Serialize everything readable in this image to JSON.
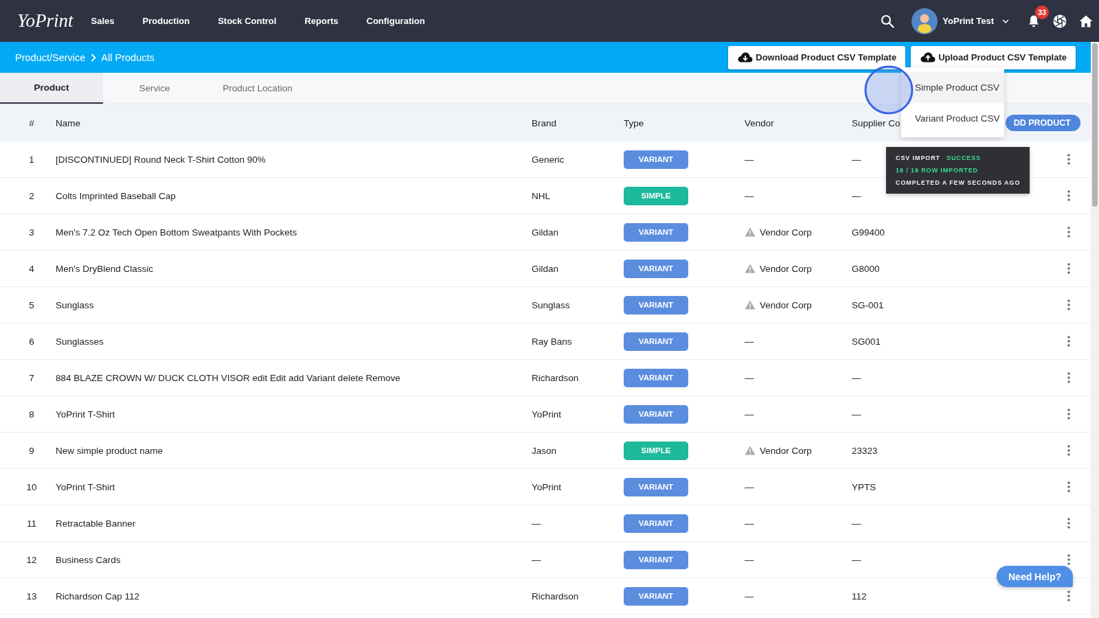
{
  "nav": {
    "logo": "YoPrint",
    "menu": [
      "Sales",
      "Production",
      "Stock Control",
      "Reports",
      "Configuration"
    ],
    "user": "YoPrint Test",
    "notification_count": "33"
  },
  "header_bar": {
    "breadcrumb": [
      "Product/Service",
      "All Products"
    ],
    "buttons": [
      {
        "label": "Download Product CSV Template",
        "kind": "download"
      },
      {
        "label": "Upload Product CSV Template",
        "kind": "upload"
      }
    ]
  },
  "upload_menu": {
    "items": [
      {
        "label": "Simple Product CSV",
        "highlighted": true
      },
      {
        "label": "Variant Product CSV",
        "highlighted": false
      }
    ]
  },
  "tabs": [
    {
      "label": "Product",
      "selected": true
    },
    {
      "label": "Service",
      "selected": false
    },
    {
      "label": "Product Location",
      "selected": false
    }
  ],
  "table": {
    "columns": [
      "#",
      "Name",
      "Brand",
      "Type",
      "Vendor",
      "Supplier Co"
    ],
    "add_button": "DD PRODUCT",
    "rows": [
      {
        "no": "1",
        "name": "[DISCONTINUED] Round Neck T-Shirt Cotton 90%",
        "brand": "Generic",
        "type": {
          "label": "VARIANT",
          "color": "#5b8ddf"
        },
        "vendor": "—",
        "vendor_warning": false,
        "supplier_code": "—"
      },
      {
        "no": "2",
        "name": "Colts Imprinted Baseball Cap",
        "brand": "NHL",
        "type": {
          "label": "SIMPLE",
          "color": "#1cb99b"
        },
        "vendor": "—",
        "vendor_warning": false,
        "supplier_code": "—"
      },
      {
        "no": "3",
        "name": "Men's 7.2 Oz Tech Open Bottom Sweatpants With Pockets",
        "brand": "Gildan",
        "type": {
          "label": "VARIANT",
          "color": "#5b8ddf"
        },
        "vendor": "Vendor Corp",
        "vendor_warning": true,
        "supplier_code": "G99400"
      },
      {
        "no": "4",
        "name": "Men's DryBlend Classic",
        "brand": "Gildan",
        "type": {
          "label": "VARIANT",
          "color": "#5b8ddf"
        },
        "vendor": "Vendor Corp",
        "vendor_warning": true,
        "supplier_code": "G8000"
      },
      {
        "no": "5",
        "name": "Sunglass",
        "brand": "Sunglass",
        "type": {
          "label": "VARIANT",
          "color": "#5b8ddf"
        },
        "vendor": "Vendor Corp",
        "vendor_warning": true,
        "supplier_code": "SG-001"
      },
      {
        "no": "6",
        "name": "Sunglasses",
        "brand": "Ray Bans",
        "type": {
          "label": "VARIANT",
          "color": "#5b8ddf"
        },
        "vendor": "—",
        "vendor_warning": false,
        "supplier_code": "SG001"
      },
      {
        "no": "7",
        "name": "884 BLAZE CROWN W/ DUCK CLOTH VISOR edit Edit add Variant delete Remove",
        "brand": "Richardson",
        "type": {
          "label": "VARIANT",
          "color": "#5b8ddf"
        },
        "vendor": "—",
        "vendor_warning": false,
        "supplier_code": "—"
      },
      {
        "no": "8",
        "name": "YoPrint T-Shirt",
        "brand": "YoPrint",
        "type": {
          "label": "VARIANT",
          "color": "#5b8ddf"
        },
        "vendor": "—",
        "vendor_warning": false,
        "supplier_code": "—"
      },
      {
        "no": "9",
        "name": "New simple product name",
        "brand": "Jason",
        "type": {
          "label": "SIMPLE",
          "color": "#1cb99b"
        },
        "vendor": "Vendor Corp",
        "vendor_warning": true,
        "supplier_code": "23323"
      },
      {
        "no": "10",
        "name": "YoPrint T-Shirt",
        "brand": "YoPrint",
        "type": {
          "label": "VARIANT",
          "color": "#5b8ddf"
        },
        "vendor": "—",
        "vendor_warning": false,
        "supplier_code": "YPTS"
      },
      {
        "no": "11",
        "name": "Retractable Banner",
        "brand": "—",
        "type": {
          "label": "VARIANT",
          "color": "#5b8ddf"
        },
        "vendor": "—",
        "vendor_warning": false,
        "supplier_code": "—"
      },
      {
        "no": "12",
        "name": "Business Cards",
        "brand": "—",
        "type": {
          "label": "VARIANT",
          "color": "#5b8ddf"
        },
        "vendor": "—",
        "vendor_warning": false,
        "supplier_code": "—"
      },
      {
        "no": "13",
        "name": "Richardson Cap 112",
        "brand": "Richardson",
        "type": {
          "label": "VARIANT",
          "color": "#5b8ddf"
        },
        "vendor": "—",
        "vendor_warning": false,
        "supplier_code": "112"
      }
    ]
  },
  "toast": {
    "title": "CSV IMPORT",
    "status": "SUCCESS",
    "detail": "16 / 16 ROW IMPORTED",
    "time": "COMPLETED A FEW SECONDS AGO"
  },
  "help_button": "Need Help?"
}
